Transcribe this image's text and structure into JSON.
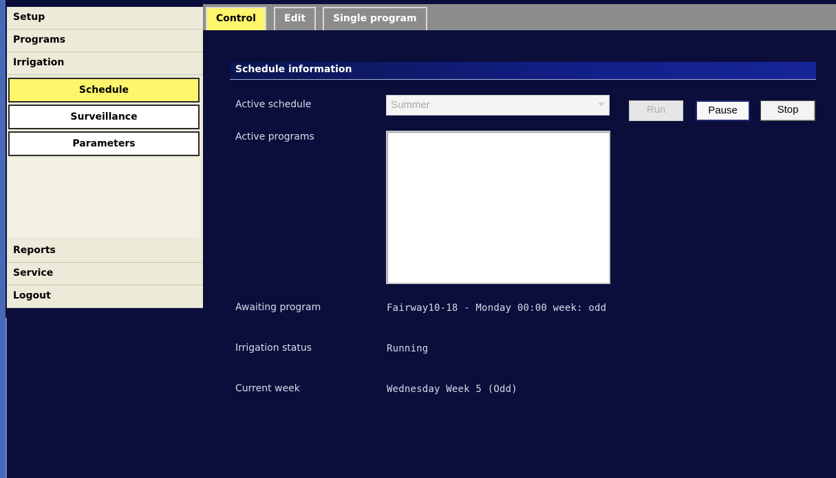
{
  "sidebar": {
    "top_items": [
      "Setup",
      "Programs",
      "Irrigation"
    ],
    "sub_items": [
      "Schedule",
      "Surveillance",
      "Parameters"
    ],
    "active_sub": "Schedule",
    "bottom_items": [
      "Reports",
      "Service",
      "Logout"
    ]
  },
  "tabs": [
    "Control",
    "Edit",
    "Single program"
  ],
  "active_tab": "Control",
  "section": {
    "title": "Schedule information"
  },
  "form": {
    "active_schedule_label": "Active schedule",
    "active_schedule_value": "Summer",
    "active_programs_label": "Active programs",
    "active_programs": [],
    "awaiting_program_label": "Awaiting program",
    "awaiting_program_value": "Fairway10-18 - Monday 00:00 week: odd",
    "irrigation_status_label": "Irrigation status",
    "irrigation_status_value": "Running",
    "current_week_label": "Current week",
    "current_week_value": "Wednesday Week 5 (Odd)"
  },
  "buttons": {
    "run": "Run",
    "pause": "Pause",
    "stop": "Stop"
  },
  "colors": {
    "background": "#0b0e3b",
    "accent_yellow": "#fff56c",
    "menu_bg": "#ecead8",
    "header_blue": "#162597"
  }
}
